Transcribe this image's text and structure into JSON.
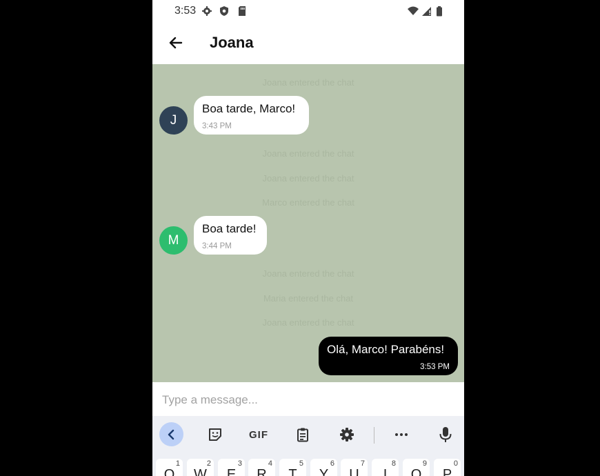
{
  "status": {
    "time": "3:53"
  },
  "header": {
    "title": "Joana"
  },
  "chat": {
    "system": [
      "Joana entered the chat",
      "Joana entered the chat",
      "Joana entered the chat",
      "Marco entered the chat",
      "Joana entered the chat",
      "Maria entered the chat",
      "Joana entered the chat"
    ],
    "messages": [
      {
        "avatar": "J",
        "avatar_color": "#2f4256",
        "text": "Boa tarde, Marco!",
        "time": "3:43 PM"
      },
      {
        "avatar": "M",
        "avatar_color": "#2dbd6e",
        "text": "Boa tarde!",
        "time": "3:44 PM"
      },
      {
        "text": "Olá, Marco! Parabéns!",
        "time": "3:53 PM"
      }
    ],
    "background": "#b8c5ae"
  },
  "composer": {
    "placeholder": "Type a message..."
  },
  "keyboard": {
    "toolbar": {
      "gif": "GIF"
    },
    "keys": [
      {
        "k": "Q",
        "n": "1"
      },
      {
        "k": "W",
        "n": "2"
      },
      {
        "k": "E",
        "n": "3"
      },
      {
        "k": "R",
        "n": "4"
      },
      {
        "k": "T",
        "n": "5"
      },
      {
        "k": "Y",
        "n": "6"
      },
      {
        "k": "U",
        "n": "7"
      },
      {
        "k": "I",
        "n": "8"
      },
      {
        "k": "O",
        "n": "9"
      },
      {
        "k": "P",
        "n": "0"
      }
    ]
  }
}
